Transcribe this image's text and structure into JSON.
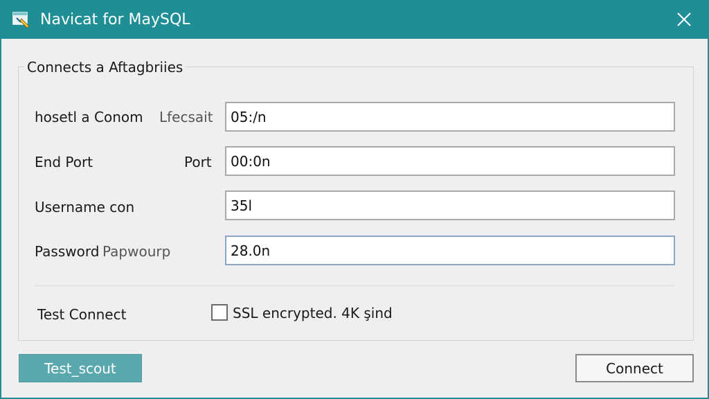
{
  "window": {
    "title": "Navicat for MaySQL",
    "accent_color": "#1f8f95",
    "icons": {
      "app": "app-window-icon",
      "close": "close-icon"
    }
  },
  "group": {
    "title": "Connects a Aftagbriies"
  },
  "rows": [
    {
      "label": "hosetl a Conom",
      "secondary_label": "Lfecsait",
      "value": "05:/n"
    },
    {
      "label": "End Port",
      "secondary_label": "Port",
      "value": "00:0n"
    },
    {
      "label": "Username  con",
      "secondary_label": "",
      "value": "35l"
    },
    {
      "label": "Password",
      "secondary_label": "Papwourp",
      "value": "28.0n"
    }
  ],
  "test_connect_label": "Test Connect",
  "ssl": {
    "label": "SSL encrypted. 4K şind",
    "checked": false
  },
  "buttons": {
    "test": "Test_scout",
    "connect": "Connect"
  }
}
